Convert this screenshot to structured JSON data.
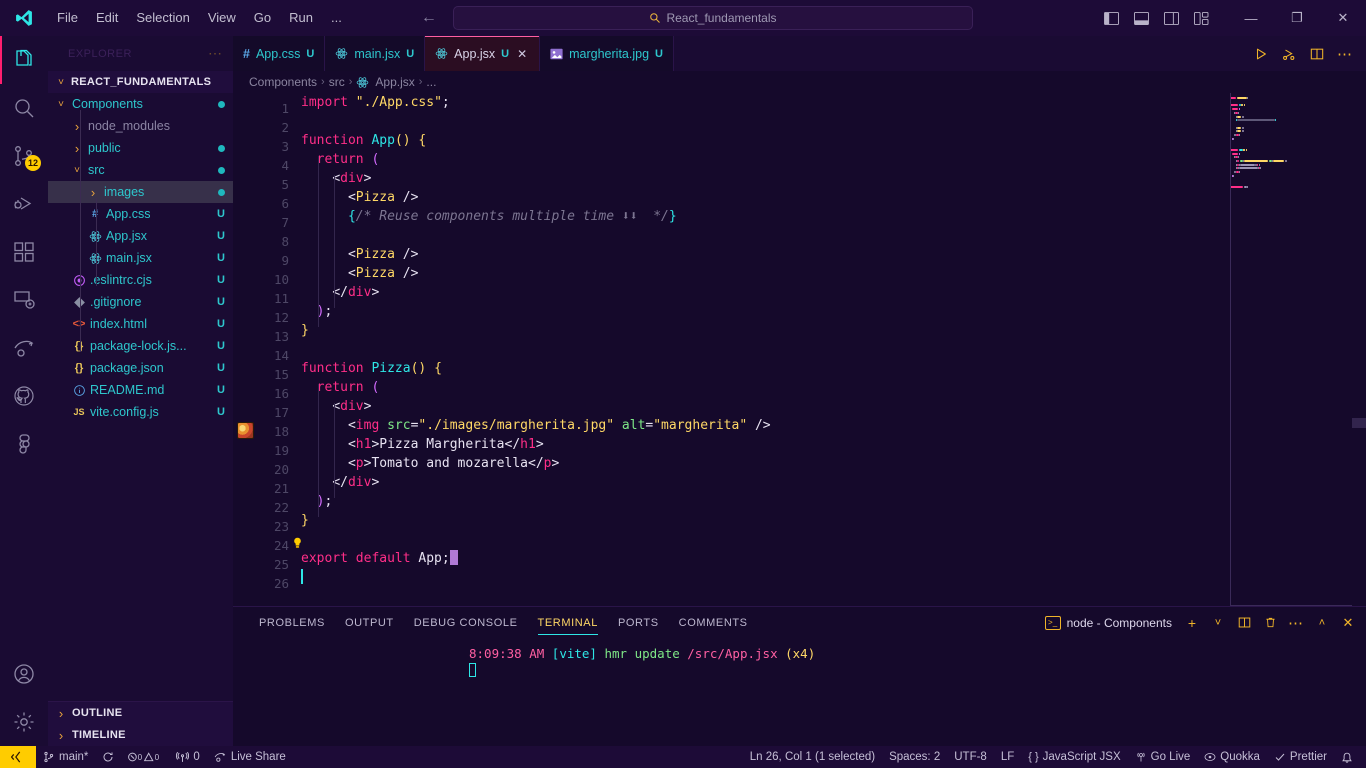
{
  "titlebar": {
    "logo_icon": "vscode-logo-icon",
    "menus": [
      "File",
      "Edit",
      "Selection",
      "View",
      "Go",
      "Run",
      "..."
    ],
    "back_icon": "arrow-left-icon",
    "forward_icon": "arrow-right-icon",
    "command_center": {
      "search_icon": "search-icon",
      "text": "React_fundamentals"
    },
    "layout_buttons": [
      "toggle-primary-sidebar-icon",
      "toggle-panel-icon",
      "toggle-secondary-sidebar-icon",
      "customize-layout-icon"
    ],
    "window_buttons": {
      "minimize": "—",
      "maximize": "❐",
      "close": "✕"
    }
  },
  "activitybar": {
    "top": [
      {
        "name": "explorer",
        "icon": "files-icon",
        "active": true,
        "badge": ""
      },
      {
        "name": "search",
        "icon": "search-icon",
        "active": false,
        "badge": ""
      },
      {
        "name": "source-control",
        "icon": "source-control-icon",
        "active": false,
        "badge": "12"
      },
      {
        "name": "run-and-debug",
        "icon": "run-debug-icon",
        "active": false,
        "badge": ""
      },
      {
        "name": "extensions",
        "icon": "extensions-icon",
        "active": false,
        "badge": ""
      },
      {
        "name": "remote-explorer",
        "icon": "remote-explorer-icon",
        "active": false,
        "badge": ""
      },
      {
        "name": "live-share",
        "icon": "live-share-icon",
        "active": false,
        "badge": ""
      },
      {
        "name": "github",
        "icon": "github-icon",
        "active": false,
        "badge": ""
      },
      {
        "name": "figma",
        "icon": "figma-icon",
        "active": false,
        "badge": ""
      }
    ],
    "bottom": [
      {
        "name": "accounts",
        "icon": "account-icon"
      },
      {
        "name": "settings",
        "icon": "gear-icon"
      }
    ]
  },
  "sidebar": {
    "title": "EXPLORER",
    "more_icon": "ellipsis-icon",
    "root": {
      "label": "REACT_FUNDAMENTALS",
      "chevron": "chevron-down-icon"
    },
    "items": [
      {
        "label": "Components",
        "depth": 1,
        "type": "folder",
        "state": "open",
        "icon": "folder-icon",
        "status": "dot",
        "color": "teal",
        "selected": false
      },
      {
        "label": "node_modules",
        "depth": 2,
        "type": "folder",
        "state": "closed",
        "icon": "folder-icon",
        "status": "",
        "color": "dim",
        "selected": false
      },
      {
        "label": "public",
        "depth": 2,
        "type": "folder",
        "state": "closed",
        "icon": "folder-icon",
        "status": "dot",
        "color": "teal",
        "selected": false
      },
      {
        "label": "src",
        "depth": 2,
        "type": "folder",
        "state": "open",
        "icon": "folder-icon",
        "status": "dot",
        "color": "teal",
        "selected": false
      },
      {
        "label": "images",
        "depth": 3,
        "type": "folder",
        "state": "closed",
        "icon": "folder-icon",
        "status": "dot",
        "color": "teal",
        "selected": true
      },
      {
        "label": "App.css",
        "depth": 3,
        "type": "file",
        "state": "",
        "icon": "css-icon",
        "status": "U",
        "color": "teal",
        "selected": false
      },
      {
        "label": "App.jsx",
        "depth": 3,
        "type": "file",
        "state": "",
        "icon": "react-icon",
        "status": "U",
        "color": "teal",
        "selected": false
      },
      {
        "label": "main.jsx",
        "depth": 3,
        "type": "file",
        "state": "",
        "icon": "react-icon",
        "status": "U",
        "color": "teal",
        "selected": false
      },
      {
        "label": ".eslintrc.cjs",
        "depth": 2,
        "type": "file",
        "state": "",
        "icon": "eslint-icon",
        "status": "U",
        "color": "teal",
        "selected": false
      },
      {
        "label": ".gitignore",
        "depth": 2,
        "type": "file",
        "state": "",
        "icon": "git-icon",
        "status": "U",
        "color": "teal",
        "selected": false
      },
      {
        "label": "index.html",
        "depth": 2,
        "type": "file",
        "state": "",
        "icon": "html-icon",
        "status": "U",
        "color": "teal",
        "selected": false
      },
      {
        "label": "package-lock.js...",
        "depth": 2,
        "type": "file",
        "state": "",
        "icon": "json-icon",
        "status": "U",
        "color": "teal",
        "selected": false
      },
      {
        "label": "package.json",
        "depth": 2,
        "type": "file",
        "state": "",
        "icon": "json-icon",
        "status": "U",
        "color": "teal",
        "selected": false
      },
      {
        "label": "README.md",
        "depth": 2,
        "type": "file",
        "state": "",
        "icon": "info-icon",
        "status": "U",
        "color": "teal",
        "selected": false
      },
      {
        "label": "vite.config.js",
        "depth": 2,
        "type": "file",
        "state": "",
        "icon": "js-icon",
        "status": "U",
        "color": "teal",
        "selected": false
      }
    ],
    "sections": [
      {
        "label": "OUTLINE",
        "chevron": "chevron-right-icon"
      },
      {
        "label": "TIMELINE",
        "chevron": "chevron-right-icon"
      }
    ]
  },
  "tabs": [
    {
      "label": "App.css",
      "icon": "css-icon",
      "status": "U",
      "active": false,
      "closable": false
    },
    {
      "label": "main.jsx",
      "icon": "react-icon",
      "status": "U",
      "active": false,
      "closable": false
    },
    {
      "label": "App.jsx",
      "icon": "react-icon",
      "status": "U",
      "active": true,
      "closable": true
    },
    {
      "label": "margherita.jpg",
      "icon": "image-icon",
      "status": "U",
      "active": false,
      "closable": false
    }
  ],
  "tab_actions": [
    {
      "name": "run-code-button",
      "icon": "play-icon"
    },
    {
      "name": "run-and-debug-button",
      "icon": "debug-alt-icon"
    },
    {
      "name": "split-editor-button",
      "icon": "split-editor-icon"
    },
    {
      "name": "more-actions-button",
      "icon": "ellipsis-icon"
    }
  ],
  "breadcrumb": {
    "items": [
      "Components",
      "src",
      "App.jsx",
      "..."
    ],
    "file_icon": "react-icon",
    "separator": "›"
  },
  "editor": {
    "language": "JavaScript JSX",
    "first_line": 1,
    "lines": [
      {
        "n": 1,
        "tokens": [
          {
            "t": "import ",
            "c": "kw"
          },
          {
            "t": "\"./App.css\"",
            "c": "str"
          },
          {
            "t": ";",
            "c": "punc"
          }
        ]
      },
      {
        "n": 2,
        "tokens": []
      },
      {
        "n": 3,
        "tokens": [
          {
            "t": "function ",
            "c": "kw"
          },
          {
            "t": "App",
            "c": "fn"
          },
          {
            "t": "(",
            "c": "brk1"
          },
          {
            "t": ")",
            "c": "brk1"
          },
          {
            "t": " ",
            "c": "plain"
          },
          {
            "t": "{",
            "c": "brk1"
          }
        ]
      },
      {
        "n": 4,
        "tokens": [
          {
            "t": "  ",
            "c": "plain"
          },
          {
            "t": "return",
            "c": "kw"
          },
          {
            "t": " ",
            "c": "plain"
          },
          {
            "t": "(",
            "c": "brk2"
          }
        ]
      },
      {
        "n": 5,
        "tokens": [
          {
            "t": "    ",
            "c": "plain"
          },
          {
            "t": "<",
            "c": "punc"
          },
          {
            "t": "div",
            "c": "tag"
          },
          {
            "t": ">",
            "c": "punc"
          }
        ]
      },
      {
        "n": 6,
        "tokens": [
          {
            "t": "      ",
            "c": "plain"
          },
          {
            "t": "<",
            "c": "punc"
          },
          {
            "t": "Pizza",
            "c": "comp"
          },
          {
            "t": " />",
            "c": "punc"
          }
        ]
      },
      {
        "n": 7,
        "tokens": [
          {
            "t": "      ",
            "c": "plain"
          },
          {
            "t": "{",
            "c": "brk3"
          },
          {
            "t": "/* Reuse components multiple time ⬇⬇  */",
            "c": "com"
          },
          {
            "t": "}",
            "c": "brk3"
          }
        ]
      },
      {
        "n": 8,
        "tokens": []
      },
      {
        "n": 9,
        "tokens": [
          {
            "t": "      ",
            "c": "plain"
          },
          {
            "t": "<",
            "c": "punc"
          },
          {
            "t": "Pizza",
            "c": "comp"
          },
          {
            "t": " />",
            "c": "punc"
          }
        ]
      },
      {
        "n": 10,
        "tokens": [
          {
            "t": "      ",
            "c": "plain"
          },
          {
            "t": "<",
            "c": "punc"
          },
          {
            "t": "Pizza",
            "c": "comp"
          },
          {
            "t": " />",
            "c": "punc"
          }
        ]
      },
      {
        "n": 11,
        "tokens": [
          {
            "t": "    ",
            "c": "plain"
          },
          {
            "t": "</",
            "c": "punc"
          },
          {
            "t": "div",
            "c": "tag"
          },
          {
            "t": ">",
            "c": "punc"
          }
        ]
      },
      {
        "n": 12,
        "tokens": [
          {
            "t": "  ",
            "c": "plain"
          },
          {
            "t": ")",
            "c": "brk2"
          },
          {
            "t": ";",
            "c": "punc"
          }
        ]
      },
      {
        "n": 13,
        "tokens": [
          {
            "t": "}",
            "c": "brk1"
          }
        ]
      },
      {
        "n": 14,
        "tokens": []
      },
      {
        "n": 15,
        "tokens": [
          {
            "t": "function ",
            "c": "kw"
          },
          {
            "t": "Pizza",
            "c": "fn"
          },
          {
            "t": "(",
            "c": "brk1"
          },
          {
            "t": ")",
            "c": "brk1"
          },
          {
            "t": " ",
            "c": "plain"
          },
          {
            "t": "{",
            "c": "brk1"
          }
        ]
      },
      {
        "n": 16,
        "tokens": [
          {
            "t": "  ",
            "c": "plain"
          },
          {
            "t": "return",
            "c": "kw"
          },
          {
            "t": " ",
            "c": "plain"
          },
          {
            "t": "(",
            "c": "brk2"
          }
        ]
      },
      {
        "n": 17,
        "tokens": [
          {
            "t": "    ",
            "c": "plain"
          },
          {
            "t": "<",
            "c": "punc"
          },
          {
            "t": "div",
            "c": "tag"
          },
          {
            "t": ">",
            "c": "punc"
          }
        ]
      },
      {
        "n": 18,
        "tokens": [
          {
            "t": "      ",
            "c": "plain"
          },
          {
            "t": "<",
            "c": "punc"
          },
          {
            "t": "img",
            "c": "tag"
          },
          {
            "t": " ",
            "c": "plain"
          },
          {
            "t": "src",
            "c": "attr"
          },
          {
            "t": "=",
            "c": "punc"
          },
          {
            "t": "\"./images/margherita.jpg\"",
            "c": "str"
          },
          {
            "t": " ",
            "c": "plain"
          },
          {
            "t": "alt",
            "c": "attr"
          },
          {
            "t": "=",
            "c": "punc"
          },
          {
            "t": "\"margherita\"",
            "c": "str"
          },
          {
            "t": " />",
            "c": "punc"
          }
        ]
      },
      {
        "n": 19,
        "tokens": [
          {
            "t": "      ",
            "c": "plain"
          },
          {
            "t": "<",
            "c": "punc"
          },
          {
            "t": "h1",
            "c": "tag"
          },
          {
            "t": ">",
            "c": "punc"
          },
          {
            "t": "Pizza Margherita",
            "c": "plain"
          },
          {
            "t": "</",
            "c": "punc"
          },
          {
            "t": "h1",
            "c": "tag"
          },
          {
            "t": ">",
            "c": "punc"
          }
        ]
      },
      {
        "n": 20,
        "tokens": [
          {
            "t": "      ",
            "c": "plain"
          },
          {
            "t": "<",
            "c": "punc"
          },
          {
            "t": "p",
            "c": "tag"
          },
          {
            "t": ">",
            "c": "punc"
          },
          {
            "t": "Tomato and mozarella",
            "c": "plain"
          },
          {
            "t": "</",
            "c": "punc"
          },
          {
            "t": "p",
            "c": "tag"
          },
          {
            "t": ">",
            "c": "punc"
          }
        ]
      },
      {
        "n": 21,
        "tokens": [
          {
            "t": "    ",
            "c": "plain"
          },
          {
            "t": "</",
            "c": "punc"
          },
          {
            "t": "div",
            "c": "tag"
          },
          {
            "t": ">",
            "c": "punc"
          }
        ]
      },
      {
        "n": 22,
        "tokens": [
          {
            "t": "  ",
            "c": "plain"
          },
          {
            "t": ")",
            "c": "brk2"
          },
          {
            "t": ";",
            "c": "punc"
          }
        ]
      },
      {
        "n": 23,
        "tokens": [
          {
            "t": "}",
            "c": "brk1"
          }
        ]
      },
      {
        "n": 24,
        "tokens": []
      },
      {
        "n": 25,
        "tokens": [
          {
            "t": "export default ",
            "c": "kw"
          },
          {
            "t": "App",
            "c": "plain"
          },
          {
            "t": ";",
            "c": "punc"
          }
        ]
      },
      {
        "n": 26,
        "tokens": []
      }
    ],
    "gutter_image_line": 18,
    "lightbulb_line": 24,
    "lightbulb_icon": "lightbulb-icon",
    "block_cursor_line": 25,
    "caret_line": 26
  },
  "panel": {
    "tabs": [
      "PROBLEMS",
      "OUTPUT",
      "DEBUG CONSOLE",
      "TERMINAL",
      "PORTS",
      "COMMENTS"
    ],
    "active_tab": "TERMINAL",
    "terminal_name": "node - Components",
    "terminal_icon": "terminal-icon",
    "actions": [
      {
        "name": "new-terminal-button",
        "icon": "plus-icon"
      },
      {
        "name": "terminal-dropdown",
        "icon": "chevron-down-icon"
      },
      {
        "name": "split-terminal-button",
        "icon": "split-icon"
      },
      {
        "name": "kill-terminal-button",
        "icon": "trash-icon"
      },
      {
        "name": "panel-more-button",
        "icon": "ellipsis-icon"
      },
      {
        "name": "maximize-panel-button",
        "icon": "chevron-up-icon"
      },
      {
        "name": "close-panel-button",
        "icon": "close-icon"
      }
    ],
    "output": {
      "time": "8:09:38 AM",
      "tag": "[vite]",
      "message": "hmr update",
      "path": "/src/App.jsx",
      "count": "(x4)"
    }
  },
  "statusbar": {
    "remote_icon": "remote-window-icon",
    "left": [
      {
        "name": "branch",
        "icon": "source-control-icon",
        "label": "main*"
      },
      {
        "name": "sync-changes",
        "icon": "sync-icon",
        "label": ""
      },
      {
        "name": "problems",
        "icon": "error-warning-icon",
        "label": "0 0"
      },
      {
        "name": "ports",
        "icon": "radio-tower-icon",
        "label": "0"
      },
      {
        "name": "live-share",
        "icon": "live-share-icon",
        "label": "Live Share"
      }
    ],
    "right": [
      {
        "name": "editor-selection",
        "icon": "",
        "label": "Ln 26, Col 1 (1 selected)"
      },
      {
        "name": "indentation",
        "icon": "",
        "label": "Spaces: 2"
      },
      {
        "name": "encoding",
        "icon": "",
        "label": "UTF-8"
      },
      {
        "name": "eol",
        "icon": "",
        "label": "LF"
      },
      {
        "name": "language-mode",
        "icon": "json-icon",
        "label": "JavaScript JSX"
      },
      {
        "name": "go-live",
        "icon": "broadcast-icon",
        "label": "Go Live"
      },
      {
        "name": "quokka",
        "icon": "quokka-icon",
        "label": "Quokka"
      },
      {
        "name": "prettier",
        "icon": "check-icon",
        "label": "Prettier"
      },
      {
        "name": "notifications",
        "icon": "bell-icon",
        "label": ""
      }
    ]
  },
  "colors": {
    "accent_pink": "#ff1e6f",
    "accent_teal": "#2ee6e6",
    "accent_yellow": "#ffcc00",
    "editor_bg": "#15092b",
    "sidebar_bg": "#1a0b33",
    "titlebar_bg": "#1d0b37"
  }
}
